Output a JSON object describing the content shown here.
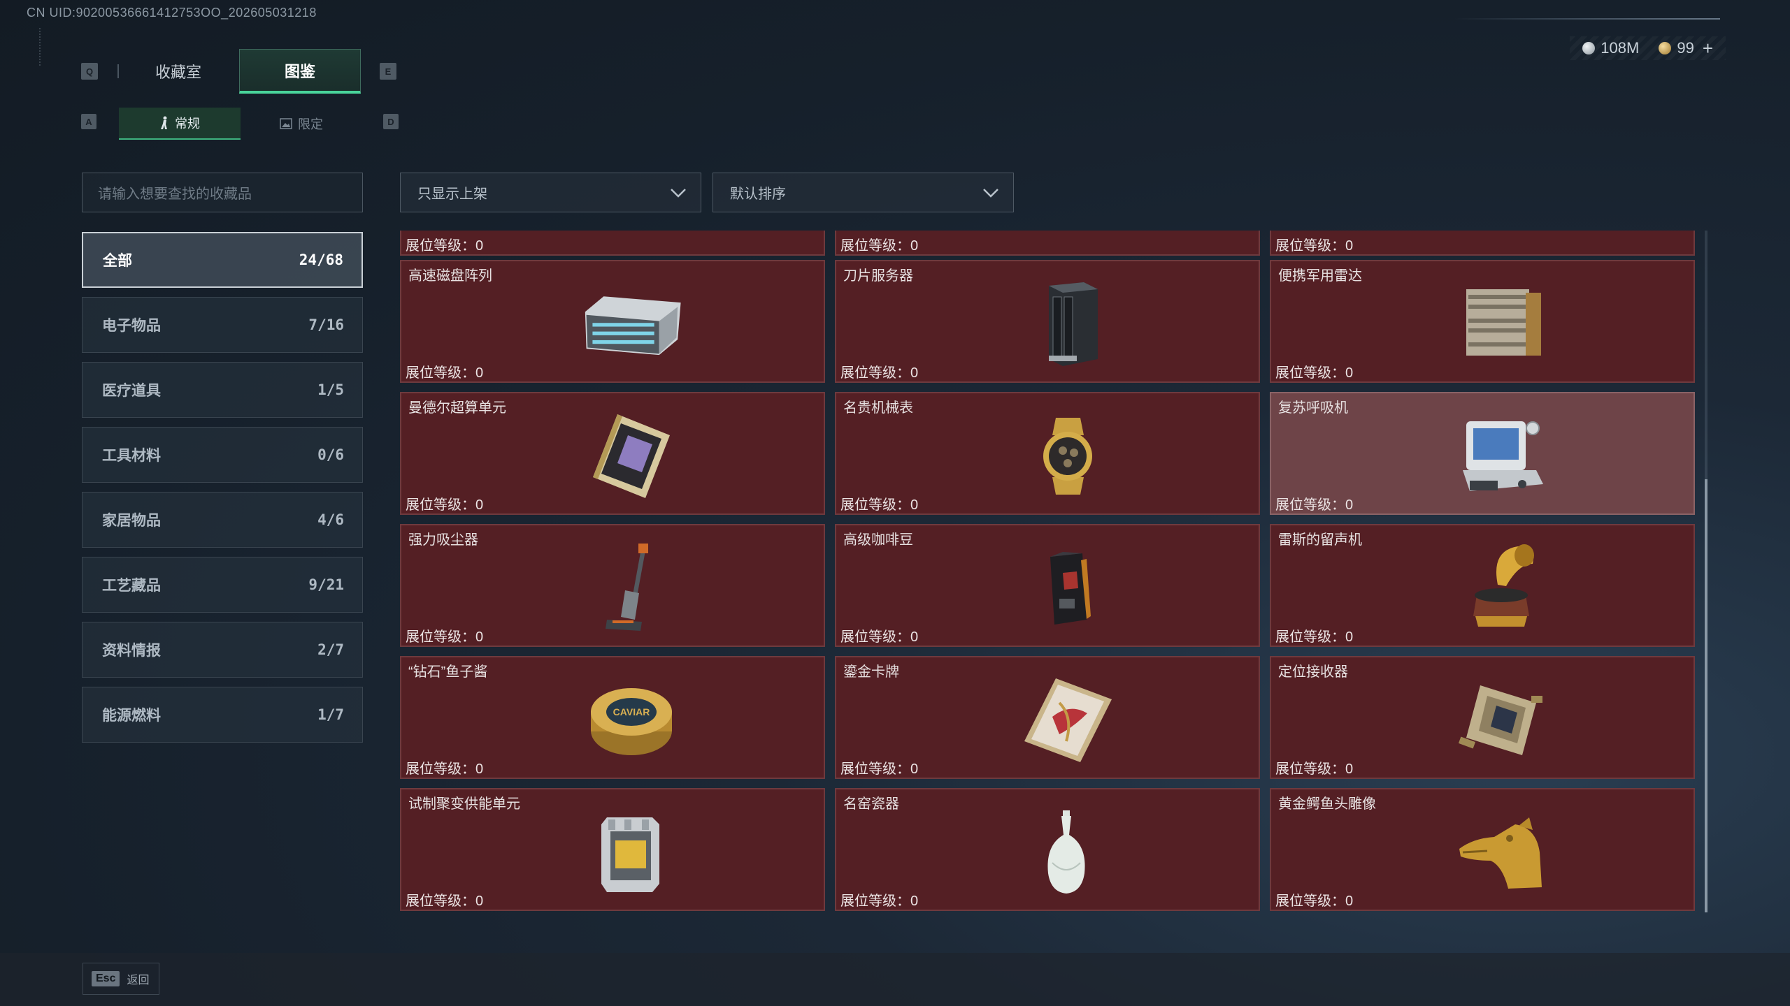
{
  "uid": "CN UID:90200536661412753OO_202605031218",
  "currency": {
    "silver": "108M",
    "gold": "99",
    "plus": "+"
  },
  "keys": {
    "prev_tab": "Q",
    "next_tab": "E",
    "prev_sub": "A",
    "next_sub": "D"
  },
  "tabs": [
    {
      "label": "收藏室"
    },
    {
      "label": "图鉴",
      "active": true
    }
  ],
  "subtabs": [
    {
      "label": "常规",
      "icon": "figure-icon",
      "active": true
    },
    {
      "label": "限定",
      "icon": "image-icon"
    }
  ],
  "search": {
    "placeholder": "请输入想要查找的收藏品"
  },
  "filters": {
    "shelf": "只显示上架",
    "sort": "默认排序"
  },
  "categories": [
    {
      "label": "全部",
      "count": "24/68",
      "active": true
    },
    {
      "label": "电子物品",
      "count": "7/16"
    },
    {
      "label": "医疗道具",
      "count": "1/5"
    },
    {
      "label": "工具材料",
      "count": "0/6"
    },
    {
      "label": "家居物品",
      "count": "4/6"
    },
    {
      "label": "工艺藏品",
      "count": "9/21"
    },
    {
      "label": "资料情报",
      "count": "2/7"
    },
    {
      "label": "能源燃料",
      "count": "1/7"
    }
  ],
  "level_label": "展位等级：",
  "items": [
    {
      "name": "",
      "level": "0",
      "icon": "item-icon"
    },
    {
      "name": "",
      "level": "0",
      "icon": "item-icon"
    },
    {
      "name": "",
      "level": "0",
      "icon": "item-icon"
    },
    {
      "name": "高速磁盘阵列",
      "level": "0",
      "icon": "disk-array-icon"
    },
    {
      "name": "刀片服务器",
      "level": "0",
      "icon": "blade-server-icon"
    },
    {
      "name": "便携军用雷达",
      "level": "0",
      "icon": "radar-icon"
    },
    {
      "name": "曼德尔超算单元",
      "level": "0",
      "icon": "supercompute-unit-icon"
    },
    {
      "name": "名贵机械表",
      "level": "0",
      "icon": "watch-icon"
    },
    {
      "name": "复苏呼吸机",
      "level": "0",
      "icon": "ventilator-icon",
      "highlighted": true
    },
    {
      "name": "强力吸尘器",
      "level": "0",
      "icon": "vacuum-icon"
    },
    {
      "name": "高级咖啡豆",
      "level": "0",
      "icon": "coffee-bag-icon"
    },
    {
      "name": "雷斯的留声机",
      "level": "0",
      "icon": "gramophone-icon"
    },
    {
      "name": "“钻石”鱼子酱",
      "level": "0",
      "icon": "caviar-tin-icon",
      "caviar_label": "CAVIAR"
    },
    {
      "name": "鎏金卡牌",
      "level": "0",
      "icon": "gilded-card-icon"
    },
    {
      "name": "定位接收器",
      "level": "0",
      "icon": "receiver-icon"
    },
    {
      "name": "试制聚变供能单元",
      "level": "0",
      "icon": "fusion-cell-icon"
    },
    {
      "name": "名窑瓷器",
      "level": "0",
      "icon": "porcelain-vase-icon"
    },
    {
      "name": "黄金鳄鱼头雕像",
      "level": "0",
      "icon": "crocodile-statue-icon"
    }
  ],
  "footer": {
    "esc_key": "Esc",
    "back": "返回"
  }
}
